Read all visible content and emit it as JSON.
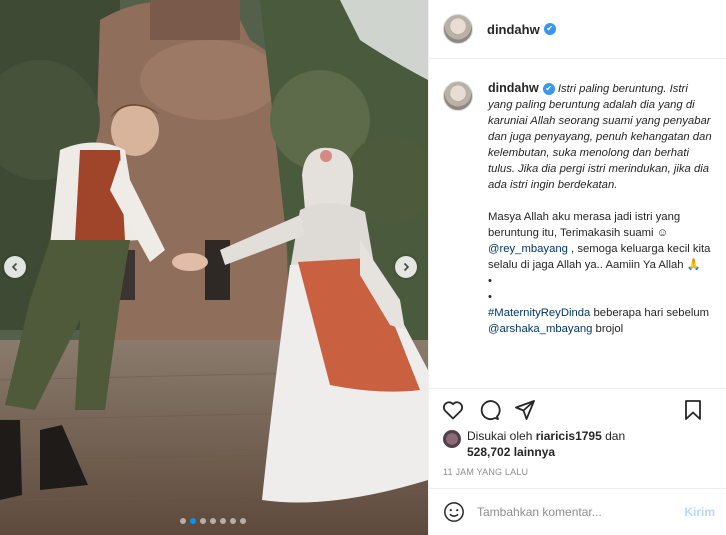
{
  "post": {
    "username": "dindahw",
    "verified_badge": "✔",
    "carousel": {
      "slide_count": 7,
      "active_slide": 2
    }
  },
  "caption": {
    "username": "dindahw",
    "italic_text": "Istri paling beruntung. Istri yang paling beruntung adalah dia yang di karuniai Allah seorang suami yang penyabar dan juga penyayang, penuh kehangatan dan kelembutan, suka menolong dan berhati tulus. Jika dia pergi istri merindukan, jika dia ada istri ingin berdekatan.",
    "para2_a": "Masya Allah aku merasa jadi istri yang beruntung itu, Terimakasih suami ☺",
    "mention1": "@rey_mbayang",
    "para2_b": " , semoga keluarga kecil kita selalu di jaga Allah ya.. Aamiin Ya Allah 🙏",
    "bullet1": "•",
    "bullet2": "•",
    "hashtag": "#MaternityReyDinda",
    "para3_a": " beberapa hari sebelum ",
    "mention2": "@arshaka_mbayang",
    "para3_b": " brojol"
  },
  "likes": {
    "prefix": "Disukai oleh",
    "user": "riaricis1795",
    "middle": "dan",
    "count": "528,702 lainnya"
  },
  "timestamp": "11 JAM YANG LALU",
  "comment": {
    "placeholder": "Tambahkan komentar...",
    "post_label": "Kirim"
  },
  "icons": {
    "like": "heart-icon",
    "comment": "comment-icon",
    "share": "paper-plane-icon",
    "save": "bookmark-icon",
    "emoji": "emoji-icon",
    "prev": "chevron-left-icon",
    "next": "chevron-right-icon"
  },
  "colors": {
    "accent_blue": "#0095f6",
    "link_blue": "#00376b",
    "verified_blue": "#3897f0",
    "post_button": "#b3dbff"
  }
}
